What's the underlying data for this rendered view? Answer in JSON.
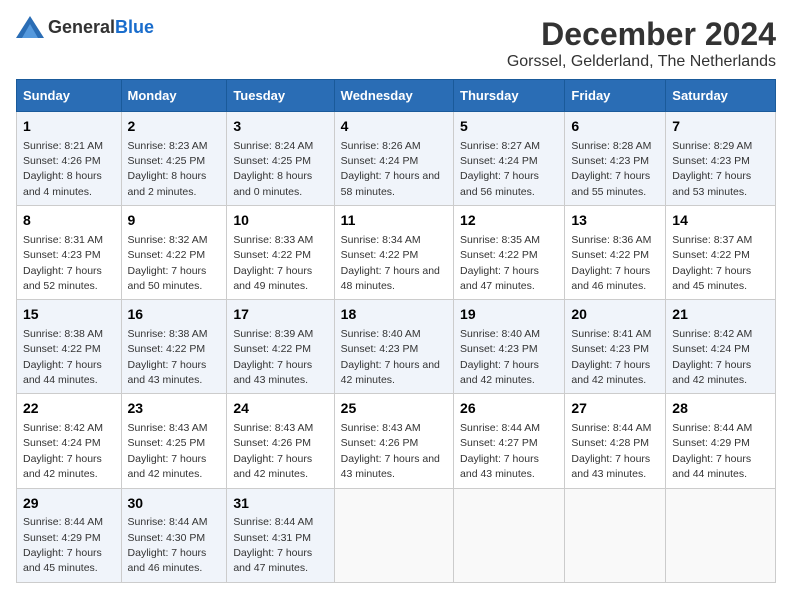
{
  "logo": {
    "general": "General",
    "blue": "Blue"
  },
  "title": "December 2024",
  "subtitle": "Gorssel, Gelderland, The Netherlands",
  "headers": [
    "Sunday",
    "Monday",
    "Tuesday",
    "Wednesday",
    "Thursday",
    "Friday",
    "Saturday"
  ],
  "rows": [
    [
      {
        "day": "1",
        "sunrise": "Sunrise: 8:21 AM",
        "sunset": "Sunset: 4:26 PM",
        "daylight": "Daylight: 8 hours and 4 minutes."
      },
      {
        "day": "2",
        "sunrise": "Sunrise: 8:23 AM",
        "sunset": "Sunset: 4:25 PM",
        "daylight": "Daylight: 8 hours and 2 minutes."
      },
      {
        "day": "3",
        "sunrise": "Sunrise: 8:24 AM",
        "sunset": "Sunset: 4:25 PM",
        "daylight": "Daylight: 8 hours and 0 minutes."
      },
      {
        "day": "4",
        "sunrise": "Sunrise: 8:26 AM",
        "sunset": "Sunset: 4:24 PM",
        "daylight": "Daylight: 7 hours and 58 minutes."
      },
      {
        "day": "5",
        "sunrise": "Sunrise: 8:27 AM",
        "sunset": "Sunset: 4:24 PM",
        "daylight": "Daylight: 7 hours and 56 minutes."
      },
      {
        "day": "6",
        "sunrise": "Sunrise: 8:28 AM",
        "sunset": "Sunset: 4:23 PM",
        "daylight": "Daylight: 7 hours and 55 minutes."
      },
      {
        "day": "7",
        "sunrise": "Sunrise: 8:29 AM",
        "sunset": "Sunset: 4:23 PM",
        "daylight": "Daylight: 7 hours and 53 minutes."
      }
    ],
    [
      {
        "day": "8",
        "sunrise": "Sunrise: 8:31 AM",
        "sunset": "Sunset: 4:23 PM",
        "daylight": "Daylight: 7 hours and 52 minutes."
      },
      {
        "day": "9",
        "sunrise": "Sunrise: 8:32 AM",
        "sunset": "Sunset: 4:22 PM",
        "daylight": "Daylight: 7 hours and 50 minutes."
      },
      {
        "day": "10",
        "sunrise": "Sunrise: 8:33 AM",
        "sunset": "Sunset: 4:22 PM",
        "daylight": "Daylight: 7 hours and 49 minutes."
      },
      {
        "day": "11",
        "sunrise": "Sunrise: 8:34 AM",
        "sunset": "Sunset: 4:22 PM",
        "daylight": "Daylight: 7 hours and 48 minutes."
      },
      {
        "day": "12",
        "sunrise": "Sunrise: 8:35 AM",
        "sunset": "Sunset: 4:22 PM",
        "daylight": "Daylight: 7 hours and 47 minutes."
      },
      {
        "day": "13",
        "sunrise": "Sunrise: 8:36 AM",
        "sunset": "Sunset: 4:22 PM",
        "daylight": "Daylight: 7 hours and 46 minutes."
      },
      {
        "day": "14",
        "sunrise": "Sunrise: 8:37 AM",
        "sunset": "Sunset: 4:22 PM",
        "daylight": "Daylight: 7 hours and 45 minutes."
      }
    ],
    [
      {
        "day": "15",
        "sunrise": "Sunrise: 8:38 AM",
        "sunset": "Sunset: 4:22 PM",
        "daylight": "Daylight: 7 hours and 44 minutes."
      },
      {
        "day": "16",
        "sunrise": "Sunrise: 8:38 AM",
        "sunset": "Sunset: 4:22 PM",
        "daylight": "Daylight: 7 hours and 43 minutes."
      },
      {
        "day": "17",
        "sunrise": "Sunrise: 8:39 AM",
        "sunset": "Sunset: 4:22 PM",
        "daylight": "Daylight: 7 hours and 43 minutes."
      },
      {
        "day": "18",
        "sunrise": "Sunrise: 8:40 AM",
        "sunset": "Sunset: 4:23 PM",
        "daylight": "Daylight: 7 hours and 42 minutes."
      },
      {
        "day": "19",
        "sunrise": "Sunrise: 8:40 AM",
        "sunset": "Sunset: 4:23 PM",
        "daylight": "Daylight: 7 hours and 42 minutes."
      },
      {
        "day": "20",
        "sunrise": "Sunrise: 8:41 AM",
        "sunset": "Sunset: 4:23 PM",
        "daylight": "Daylight: 7 hours and 42 minutes."
      },
      {
        "day": "21",
        "sunrise": "Sunrise: 8:42 AM",
        "sunset": "Sunset: 4:24 PM",
        "daylight": "Daylight: 7 hours and 42 minutes."
      }
    ],
    [
      {
        "day": "22",
        "sunrise": "Sunrise: 8:42 AM",
        "sunset": "Sunset: 4:24 PM",
        "daylight": "Daylight: 7 hours and 42 minutes."
      },
      {
        "day": "23",
        "sunrise": "Sunrise: 8:43 AM",
        "sunset": "Sunset: 4:25 PM",
        "daylight": "Daylight: 7 hours and 42 minutes."
      },
      {
        "day": "24",
        "sunrise": "Sunrise: 8:43 AM",
        "sunset": "Sunset: 4:26 PM",
        "daylight": "Daylight: 7 hours and 42 minutes."
      },
      {
        "day": "25",
        "sunrise": "Sunrise: 8:43 AM",
        "sunset": "Sunset: 4:26 PM",
        "daylight": "Daylight: 7 hours and 43 minutes."
      },
      {
        "day": "26",
        "sunrise": "Sunrise: 8:44 AM",
        "sunset": "Sunset: 4:27 PM",
        "daylight": "Daylight: 7 hours and 43 minutes."
      },
      {
        "day": "27",
        "sunrise": "Sunrise: 8:44 AM",
        "sunset": "Sunset: 4:28 PM",
        "daylight": "Daylight: 7 hours and 43 minutes."
      },
      {
        "day": "28",
        "sunrise": "Sunrise: 8:44 AM",
        "sunset": "Sunset: 4:29 PM",
        "daylight": "Daylight: 7 hours and 44 minutes."
      }
    ],
    [
      {
        "day": "29",
        "sunrise": "Sunrise: 8:44 AM",
        "sunset": "Sunset: 4:29 PM",
        "daylight": "Daylight: 7 hours and 45 minutes."
      },
      {
        "day": "30",
        "sunrise": "Sunrise: 8:44 AM",
        "sunset": "Sunset: 4:30 PM",
        "daylight": "Daylight: 7 hours and 46 minutes."
      },
      {
        "day": "31",
        "sunrise": "Sunrise: 8:44 AM",
        "sunset": "Sunset: 4:31 PM",
        "daylight": "Daylight: 7 hours and 47 minutes."
      },
      null,
      null,
      null,
      null
    ]
  ]
}
